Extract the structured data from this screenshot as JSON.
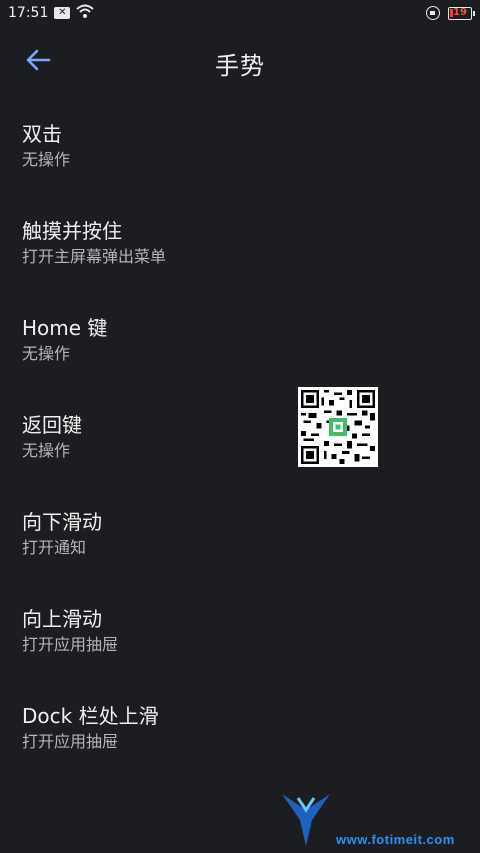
{
  "status_bar": {
    "time": "17:51",
    "notif_badge": "✕",
    "battery": "19"
  },
  "header": {
    "title": "手势"
  },
  "items": [
    {
      "title": "双击",
      "subtitle": "无操作"
    },
    {
      "title": "触摸并按住",
      "subtitle": "打开主屏幕弹出菜单"
    },
    {
      "title": "Home 键",
      "subtitle": "无操作"
    },
    {
      "title": "返回键",
      "subtitle": "无操作"
    },
    {
      "title": "向下滑动",
      "subtitle": "打开通知"
    },
    {
      "title": "向上滑动",
      "subtitle": "打开应用抽屉"
    },
    {
      "title": "Dock 栏处上滑",
      "subtitle": "打开应用抽屉"
    }
  ],
  "watermark": {
    "text": "www.fotimeit.com"
  },
  "colors": {
    "background": "#1c1d21",
    "accent": "#7aa8ff",
    "subtitle": "#b4b5b8"
  }
}
